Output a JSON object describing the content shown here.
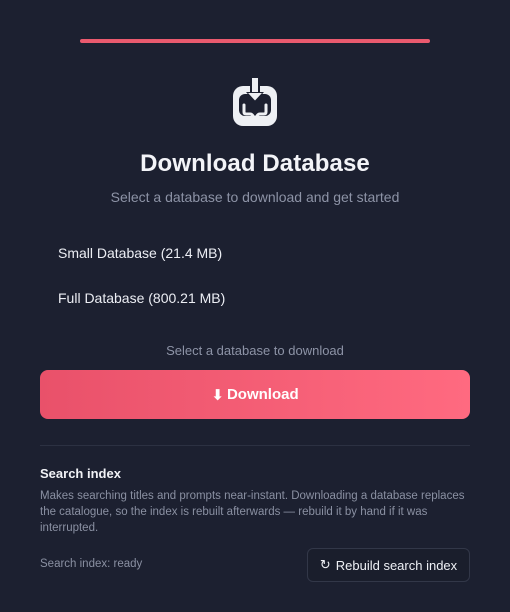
{
  "header": {
    "title": "Download Database",
    "subtitle": "Select a database to download and get started",
    "logo_icon": "download-database-icon"
  },
  "databases": [
    {
      "label": "Small Database (21.4 MB)"
    },
    {
      "label": "Full Database (800.21 MB)"
    }
  ],
  "selection_hint": "Select a database to download",
  "download_button": {
    "icon": "⬇",
    "label": "Download"
  },
  "search_index": {
    "title": "Search index",
    "description": "Makes searching titles and prompts near-instant. Downloading a database replaces the catalogue, so the index is rebuilt afterwards — rebuild it by hand if it was interrupted.",
    "status": "Search index: ready",
    "rebuild_icon": "↻",
    "rebuild_label": "Rebuild search index"
  },
  "colors": {
    "background": "#1c2030",
    "accent": "#ea5a6e",
    "accent_light": "#ff6a80"
  }
}
